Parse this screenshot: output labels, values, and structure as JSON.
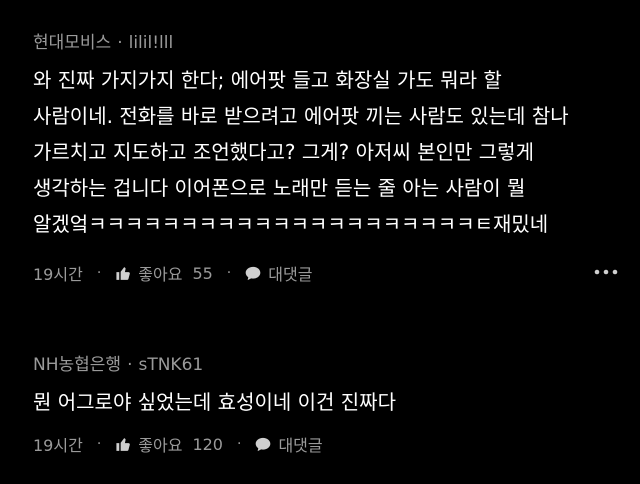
{
  "comments": [
    {
      "author": "현대모비스",
      "handle": "lilil!lll",
      "body_lines": [
        "와 진짜 가지가지 한다; 에어팟 들고 화장실 가도 뭐라 할",
        "사람이네. 전화를 바로 받으려고 에어팟 끼는 사람도 있는데 참나",
        "가르치고 지도하고 조언했다고? 그게? 아저씨 본인만 그렇게",
        "생각하는 겁니다 이어폰으로 노래만 듣는 줄 아는 사람이 뭘",
        "알겠엌ㅋㅋㅋㅋㅋㅋㅋㅋㅋㅋㅋㅋㅋㅋㅋㅋㅋㅋㅋㅋㅋㅌ재밌네"
      ],
      "time": "19시간",
      "like_label": "좋아요",
      "like_count": "55",
      "reply_label": "대댓글"
    },
    {
      "author": "NH농협은행",
      "handle": "sTNK61",
      "body_lines": [
        "뭔 어그로야 싶었는데 효성이네 이건 진짜다"
      ],
      "time": "19시간",
      "like_label": "좋아요",
      "like_count": "120",
      "reply_label": "대댓글"
    }
  ],
  "separator": "·",
  "icons": {
    "like": "thumbs-up-icon",
    "reply": "speech-bubble-icon",
    "more": "more-horizontal-icon"
  }
}
